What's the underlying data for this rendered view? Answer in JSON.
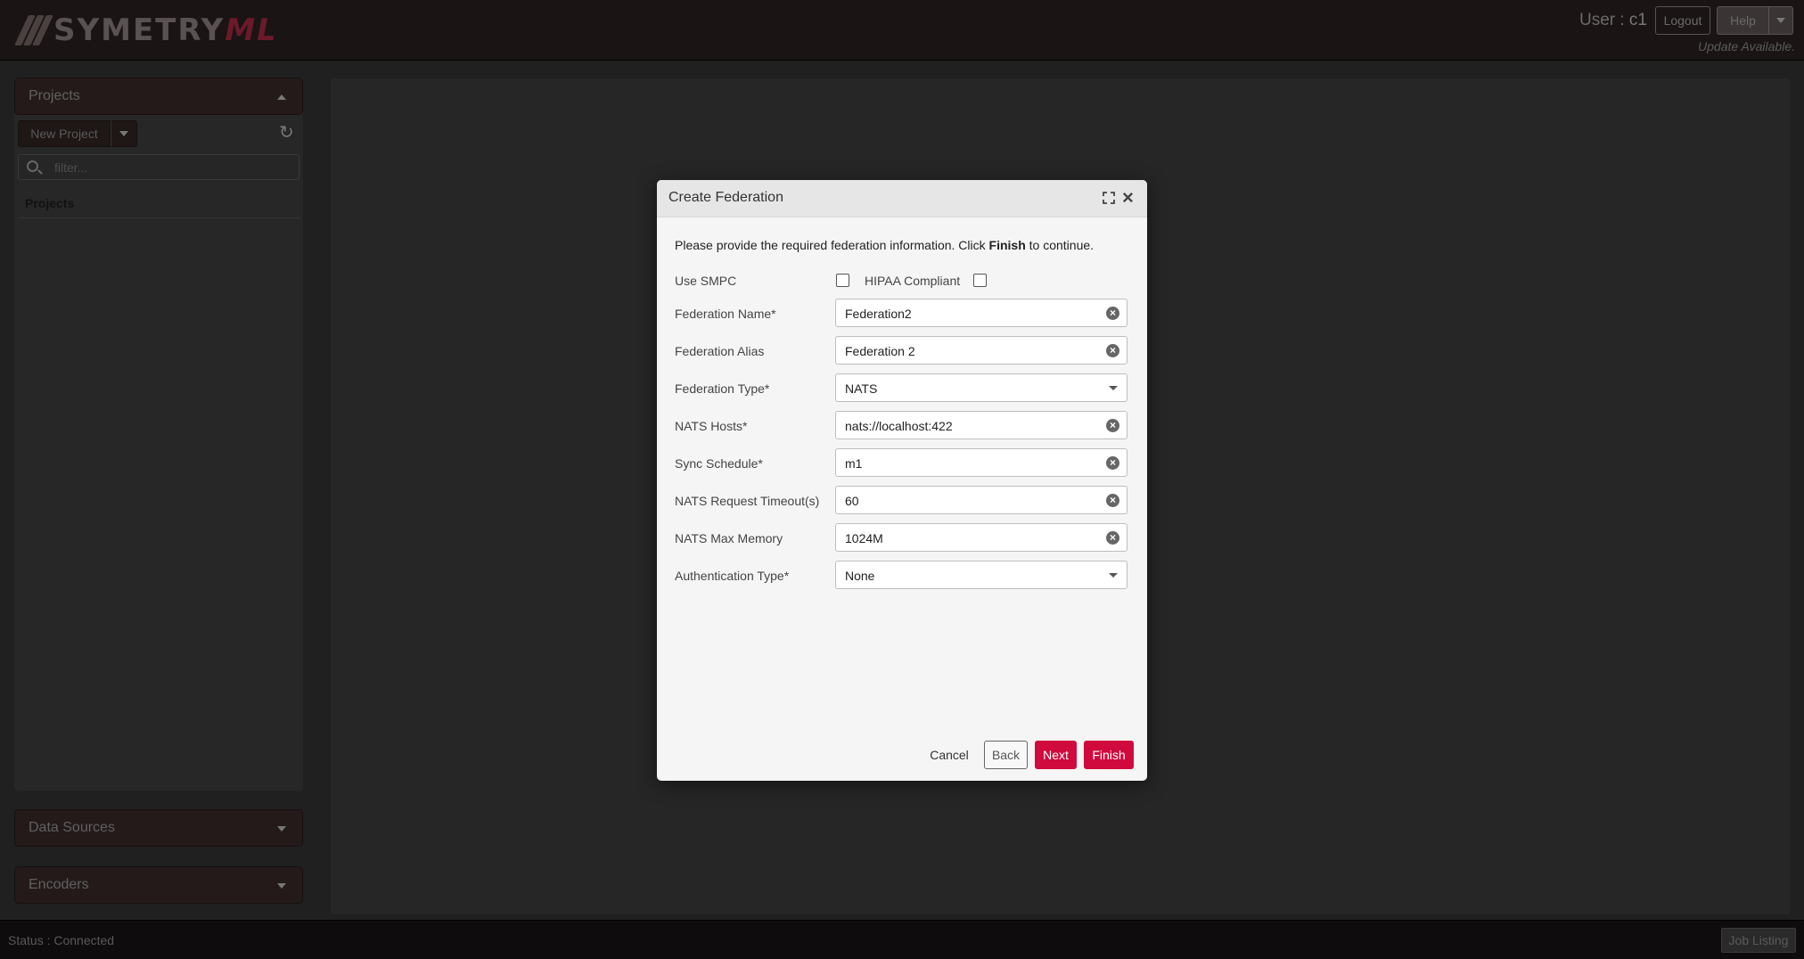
{
  "header": {
    "logo_main": "SYMETRY",
    "logo_suffix": "ML",
    "user_prefix": "User : ",
    "user_name": "c1",
    "logout_label": "Logout",
    "help_label": "Help",
    "update_text": "Update Available."
  },
  "sidebar": {
    "projects_title": "Projects",
    "new_project_label": "New Project",
    "filter_placeholder": "filter...",
    "projects_list_label": "Projects",
    "data_sources_title": "Data Sources",
    "encoders_title": "Encoders"
  },
  "footer": {
    "status": "Status : Connected",
    "job_listing_label": "Job Listing"
  },
  "dialog": {
    "title": "Create Federation",
    "intro_before": "Please provide the required federation information. Click ",
    "intro_bold": "Finish",
    "intro_after": " to continue.",
    "use_smpc_label": "Use SMPC",
    "use_smpc_checked": false,
    "hipaa_label": "HIPAA Compliant",
    "hipaa_checked": false,
    "fields": [
      {
        "label": "Federation Name*",
        "value": "Federation2",
        "type": "text"
      },
      {
        "label": "Federation Alias",
        "value": "Federation 2",
        "type": "text"
      },
      {
        "label": "Federation Type*",
        "value": "NATS",
        "type": "select"
      },
      {
        "label": "NATS Hosts*",
        "value": "nats://localhost:422",
        "type": "text"
      },
      {
        "label": "Sync Schedule*",
        "value": "m1",
        "type": "text"
      },
      {
        "label": "NATS Request Timeout(s)",
        "value": "60",
        "type": "text"
      },
      {
        "label": "NATS Max Memory",
        "value": "1024M",
        "type": "text"
      },
      {
        "label": "Authentication Type*",
        "value": "None",
        "type": "select"
      }
    ],
    "buttons": {
      "cancel": "Cancel",
      "back": "Back",
      "next": "Next",
      "finish": "Finish"
    }
  },
  "colors": {
    "accent": "#d00a3c",
    "header_bg": "#1a1414",
    "dialog_bg": "#f5f5f5"
  }
}
